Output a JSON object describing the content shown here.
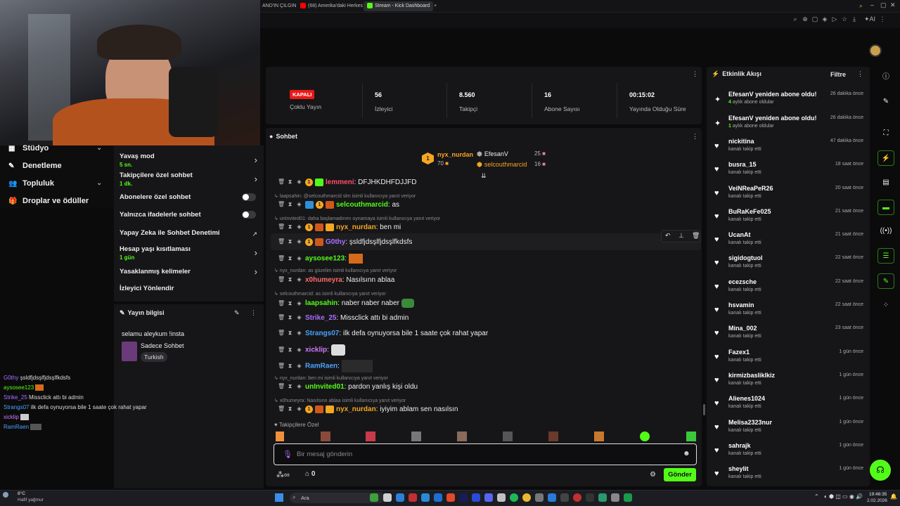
{
  "browser": {
    "tabs": [
      {
        "label": "AND'IN ÇILGIN",
        "active": false
      },
      {
        "label": "(68) Amerika'daki Herkes",
        "active": false
      },
      {
        "label": "Stream - Kick Dashboard",
        "active": true
      }
    ],
    "new_tab": "+"
  },
  "left_nav": {
    "items": [
      "Stüdyo",
      "Denetleme",
      "Topluluk",
      "Droplar ve ödüller"
    ]
  },
  "settings": {
    "slow_mode": {
      "label": "Yavaş mod",
      "value": "5 sn."
    },
    "followers_only": {
      "label": "Takipçilere özel sohbet",
      "value": "1 dk."
    },
    "subscribers_only": {
      "label": "Abonelere özel sohbet"
    },
    "emotes_only": {
      "label": "Yalnızca ifadelerle sohbet"
    },
    "ai_moderation": {
      "label": "Yapay Zeka ile Sohbet Denetimi"
    },
    "account_age": {
      "label": "Hesap yaşı kısıtlaması",
      "value": "1 gün"
    },
    "banned_words": {
      "label": "Yasaklanmış kelimeler"
    },
    "redirect": {
      "label": "İzleyici Yönlendir"
    }
  },
  "stream_info": {
    "header": "Yayın bilgisi",
    "title": "selamu aleykum !insta",
    "category": "Sadece Sohbet",
    "language": "Turkish"
  },
  "overlay_chat": [
    {
      "user": "G0thy",
      "text": "şsldfjdsşlfjdsşlfkdsfs",
      "color": "#a970ff"
    },
    {
      "user": "aysosee123",
      "text": "",
      "color": "#53fc18"
    },
    {
      "user": "Strike_25",
      "text": "Missclick attı bi admin",
      "color": "#a970ff"
    },
    {
      "user": "Strangs07",
      "text": "ilk defa oynuyorsa bile 1 saate çok rahat yapar",
      "color": "#4aa3ff"
    },
    {
      "user": "xicklip",
      "text": "",
      "color": "#d07bff"
    },
    {
      "user": "RamRaen",
      "text": "",
      "color": "#4aa3ff"
    }
  ],
  "stats": {
    "status": "KAPALI",
    "multi_stream": "Çoklu Yayın",
    "viewers": {
      "value": "56",
      "label": "İzleyici"
    },
    "followers": {
      "value": "8.560",
      "label": "Takipçi"
    },
    "subscribers": {
      "value": "16",
      "label": "Abone Sayısı"
    },
    "uptime": {
      "value": "00:15:02",
      "label": "Yayında Olduğu Süre"
    }
  },
  "chat": {
    "title": "Sohbet",
    "leaderboard": [
      {
        "rank": "1",
        "name": "nyx_nurdan",
        "count": "70"
      },
      {
        "name": "EfesanV",
        "count": "25"
      },
      {
        "name": "selcouthmarcid",
        "count": "16"
      }
    ],
    "messages": [
      {
        "reply": "",
        "user": "lemmeni",
        "text": "DFJHKDHFDJJFD",
        "color": "#ff4d6d"
      },
      {
        "reply": "laapsahin: @selcouthmarcid slm isimli kullanıcıya yanıt veriyor",
        "user": "selcouthmarcid",
        "text": "as",
        "color": "#53fc18"
      },
      {
        "reply": "unInvited01: daha başlamadınmı oynamaya isimli kullanıcıya yanıt veriyor",
        "user": "nyx_nurdan",
        "text": "ben mi",
        "color": "#f5a623"
      },
      {
        "reply": "",
        "user": "G0thy",
        "text": "şsldfjdsşlfjdsşlfkdsfs",
        "color": "#a970ff"
      },
      {
        "reply": "",
        "user": "aysosee123",
        "text": "",
        "color": "#53fc18"
      },
      {
        "reply": "nyx_nurdan: as güzelim isimli kullanıcıya yanıt veriyor",
        "user": "x0humeyra",
        "text": "Nasılsınn ablaa",
        "color": "#ff6b6b"
      },
      {
        "reply": "selcouthmarcid: as isimli kullanıcıya yanıt veriyor",
        "user": "laapsahin",
        "text": "naber naber naber",
        "color": "#53fc18"
      },
      {
        "reply": "",
        "user": "Strike_25",
        "text": "Missclick attı bi admin",
        "color": "#a970ff"
      },
      {
        "reply": "",
        "user": "Strangs07",
        "text": "ilk defa oynuyorsa bile 1 saate çok rahat yapar",
        "color": "#4aa3ff"
      },
      {
        "reply": "",
        "user": "xicklip",
        "text": "",
        "color": "#d07bff"
      },
      {
        "reply": "",
        "user": "RamRaen",
        "text": "",
        "color": "#4aa3ff"
      },
      {
        "reply": "nyx_nurdan: ben mi isimli kullanıcıya yanıt veriyor",
        "user": "unInvited01",
        "text": "pardon yanlış kişi oldu",
        "color": "#53fc18"
      },
      {
        "reply": "x0humeyra: Nasılsınn ablaa isimli kullanıcıya yanıt veriyor",
        "user": "nyx_nurdan",
        "text": "iyiyim ablam sen nasılsın",
        "color": "#f5a623"
      }
    ],
    "emote_section": "Takipçilere Özel",
    "input_placeholder": "Bir mesaj gönderin",
    "points": "0",
    "send_label": "Gönder"
  },
  "feed": {
    "title": "Etkinlik Akışı",
    "filter_label": "Filtre",
    "items": [
      {
        "type": "resub",
        "name": "EfesanV yeniden abone oldu!",
        "sub_count": "4",
        "sub": "aylık abone oldular",
        "time": "26 dakika önce"
      },
      {
        "type": "resub",
        "name": "EfesanV yeniden abone oldu!",
        "sub_count": "1",
        "sub": "aylık abone oldular",
        "time": "26 dakika önce"
      },
      {
        "type": "follow",
        "name": "nickitina",
        "sub": "kanalı takip etti",
        "time": "47 dakika önce"
      },
      {
        "type": "follow",
        "name": "busra_15",
        "sub": "kanalı takip etti",
        "time": "18 saat önce"
      },
      {
        "type": "follow",
        "name": "VeiNReaPeR26",
        "sub": "kanalı takip etti",
        "time": "20 saat önce"
      },
      {
        "type": "follow",
        "name": "BuRaKeFe025",
        "sub": "kanalı takip etti",
        "time": "21 saat önce"
      },
      {
        "type": "follow",
        "name": "UcanAt",
        "sub": "kanalı takip etti",
        "time": "21 saat önce"
      },
      {
        "type": "follow",
        "name": "sigidogtuol",
        "sub": "kanalı takip etti",
        "time": "22 saat önce"
      },
      {
        "type": "follow",
        "name": "ecezsche",
        "sub": "kanalı takip etti",
        "time": "22 saat önce"
      },
      {
        "type": "follow",
        "name": "hsvamin",
        "sub": "kanalı takip etti",
        "time": "22 saat önce"
      },
      {
        "type": "follow",
        "name": "Mina_002",
        "sub": "kanalı takip etti",
        "time": "23 saat önce"
      },
      {
        "type": "follow",
        "name": "Fazex1",
        "sub": "kanalı takip etti",
        "time": "1 gün önce"
      },
      {
        "type": "follow",
        "name": "kirmizbasliklkiz",
        "sub": "kanalı takip etti",
        "time": "1 gün önce"
      },
      {
        "type": "follow",
        "name": "Alienes1024",
        "sub": "kanalı takip etti",
        "time": "1 gün önce"
      },
      {
        "type": "follow",
        "name": "Melisa2323nur",
        "sub": "kanalı takip etti",
        "time": "1 gün önce"
      },
      {
        "type": "follow",
        "name": "sahrajk",
        "sub": "kanalı takip etti",
        "time": "1 gün önce"
      },
      {
        "type": "follow",
        "name": "sheylit",
        "sub": "kanalı takip etti",
        "time": "1 gün önce"
      }
    ]
  },
  "taskbar": {
    "weather_temp": "8°C",
    "weather_desc": "Hafif yağmur",
    "search": "Ara",
    "time": "19:48:35",
    "date": "2.02.2026"
  },
  "colors": {
    "accent": "#53fc18",
    "panel": "#161618",
    "bg": "#0b0b0c",
    "live_off": "#e91916"
  }
}
